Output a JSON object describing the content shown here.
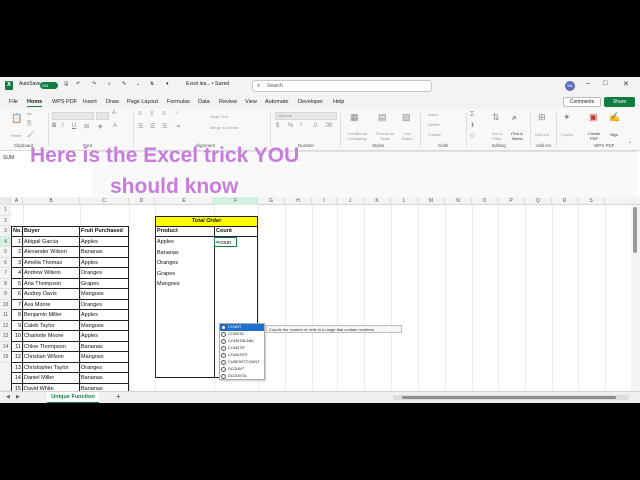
{
  "titlebar": {
    "logo": "X",
    "autosave_label": "AutoSave",
    "autosave_state": "ON",
    "filename": "Excel lea... • Saved",
    "search_placeholder": "Search",
    "avatar": "BA",
    "minimize": "–",
    "maximize": "□",
    "close": "✕"
  },
  "menu": {
    "tabs": [
      "File",
      "Home",
      "WPS PDF",
      "Insert",
      "Draw",
      "Page Layout",
      "Formulas",
      "Data",
      "Review",
      "View",
      "Automate",
      "Developer",
      "Help"
    ],
    "active": "Home",
    "comments": "Comments",
    "share": "Share"
  },
  "ribbon": {
    "groups": [
      "Clipboard",
      "Font",
      "Alignment",
      "Number",
      "Styles",
      "Cells",
      "Editing",
      "Add-ins",
      "WPS PDF"
    ],
    "paste": "Paste",
    "wrap_text": "Wrap Text",
    "merge_center": "Merge & Center",
    "number_format": "General",
    "conditional": "Conditional Formatting",
    "format_table": "Format as Table",
    "cell_styles": "Cell Styles",
    "insert": "Insert",
    "delete": "Delete",
    "format": "Format",
    "sort_filter": "Sort & Filter",
    "find_select": "Find & Select",
    "addins": "Add-ins",
    "copilot": "Copilot",
    "create_pdf": "Create PDF",
    "sign": "Sign"
  },
  "formula_bar": {
    "name_box": "SUM"
  },
  "overlay": {
    "line1": "Here is the Excel trick YOU",
    "line2": "should know",
    "color": "#c77ddb"
  },
  "columns": [
    "A",
    "B",
    "C",
    "D",
    "E",
    "F",
    "G",
    "H",
    "I",
    "J",
    "K",
    "L",
    "M",
    "N",
    "O",
    "P",
    "Q",
    "R",
    "S"
  ],
  "rows": [
    "1",
    "2",
    "3",
    "4",
    "5",
    "6",
    "7",
    "8",
    "9",
    "10",
    "11",
    "12",
    "13",
    "14",
    "15"
  ],
  "table": {
    "headers": [
      "No.",
      "Buyer",
      "Fruit Purchased"
    ],
    "data": [
      [
        "1",
        "Abigail Garcia",
        "Apples"
      ],
      [
        "2",
        "Alexander Wilson",
        "Bananas"
      ],
      [
        "3",
        "Amelia Thomas",
        "Apples"
      ],
      [
        "4",
        "Andrew Wilson",
        "Oranges"
      ],
      [
        "5",
        "Aria Thompson",
        "Grapes"
      ],
      [
        "6",
        "Audrey Davis",
        "Mangoes"
      ],
      [
        "7",
        "Ava Moore",
        "Oranges"
      ],
      [
        "8",
        "Benjamin Miller",
        "Apples"
      ],
      [
        "9",
        "Caleb Taylor",
        "Mangoes"
      ],
      [
        "10",
        "Charlotte Moore",
        "Apples"
      ],
      [
        "11",
        "Chloe Thompson",
        "Bananas"
      ],
      [
        "12",
        "Christian Wilson",
        "Mangoes"
      ],
      [
        "13",
        "Christopher Taylor",
        "Oranges"
      ],
      [
        "14",
        "Daniel Miller",
        "Bananas"
      ],
      [
        "15",
        "David White",
        "Bananas"
      ]
    ]
  },
  "order": {
    "title": "Total Order",
    "headers": [
      "Product",
      "Count"
    ],
    "products": [
      "Apples",
      "Bananas",
      "Oranges",
      "Grapes",
      "Mangoes"
    ],
    "formula": "=coun"
  },
  "autocomplete": {
    "items": [
      "COUNT",
      "COUNTA",
      "COUNTBLANK",
      "COUNTIF",
      "COUNTIFS",
      "CUBESETCOUNT",
      "DCOUNT",
      "DCOUNTA"
    ],
    "selected": "COUNT",
    "tooltip": "Counts the number of cells in a range that contain numbers"
  },
  "sheet": {
    "tab": "Unique Function",
    "add": "+"
  }
}
